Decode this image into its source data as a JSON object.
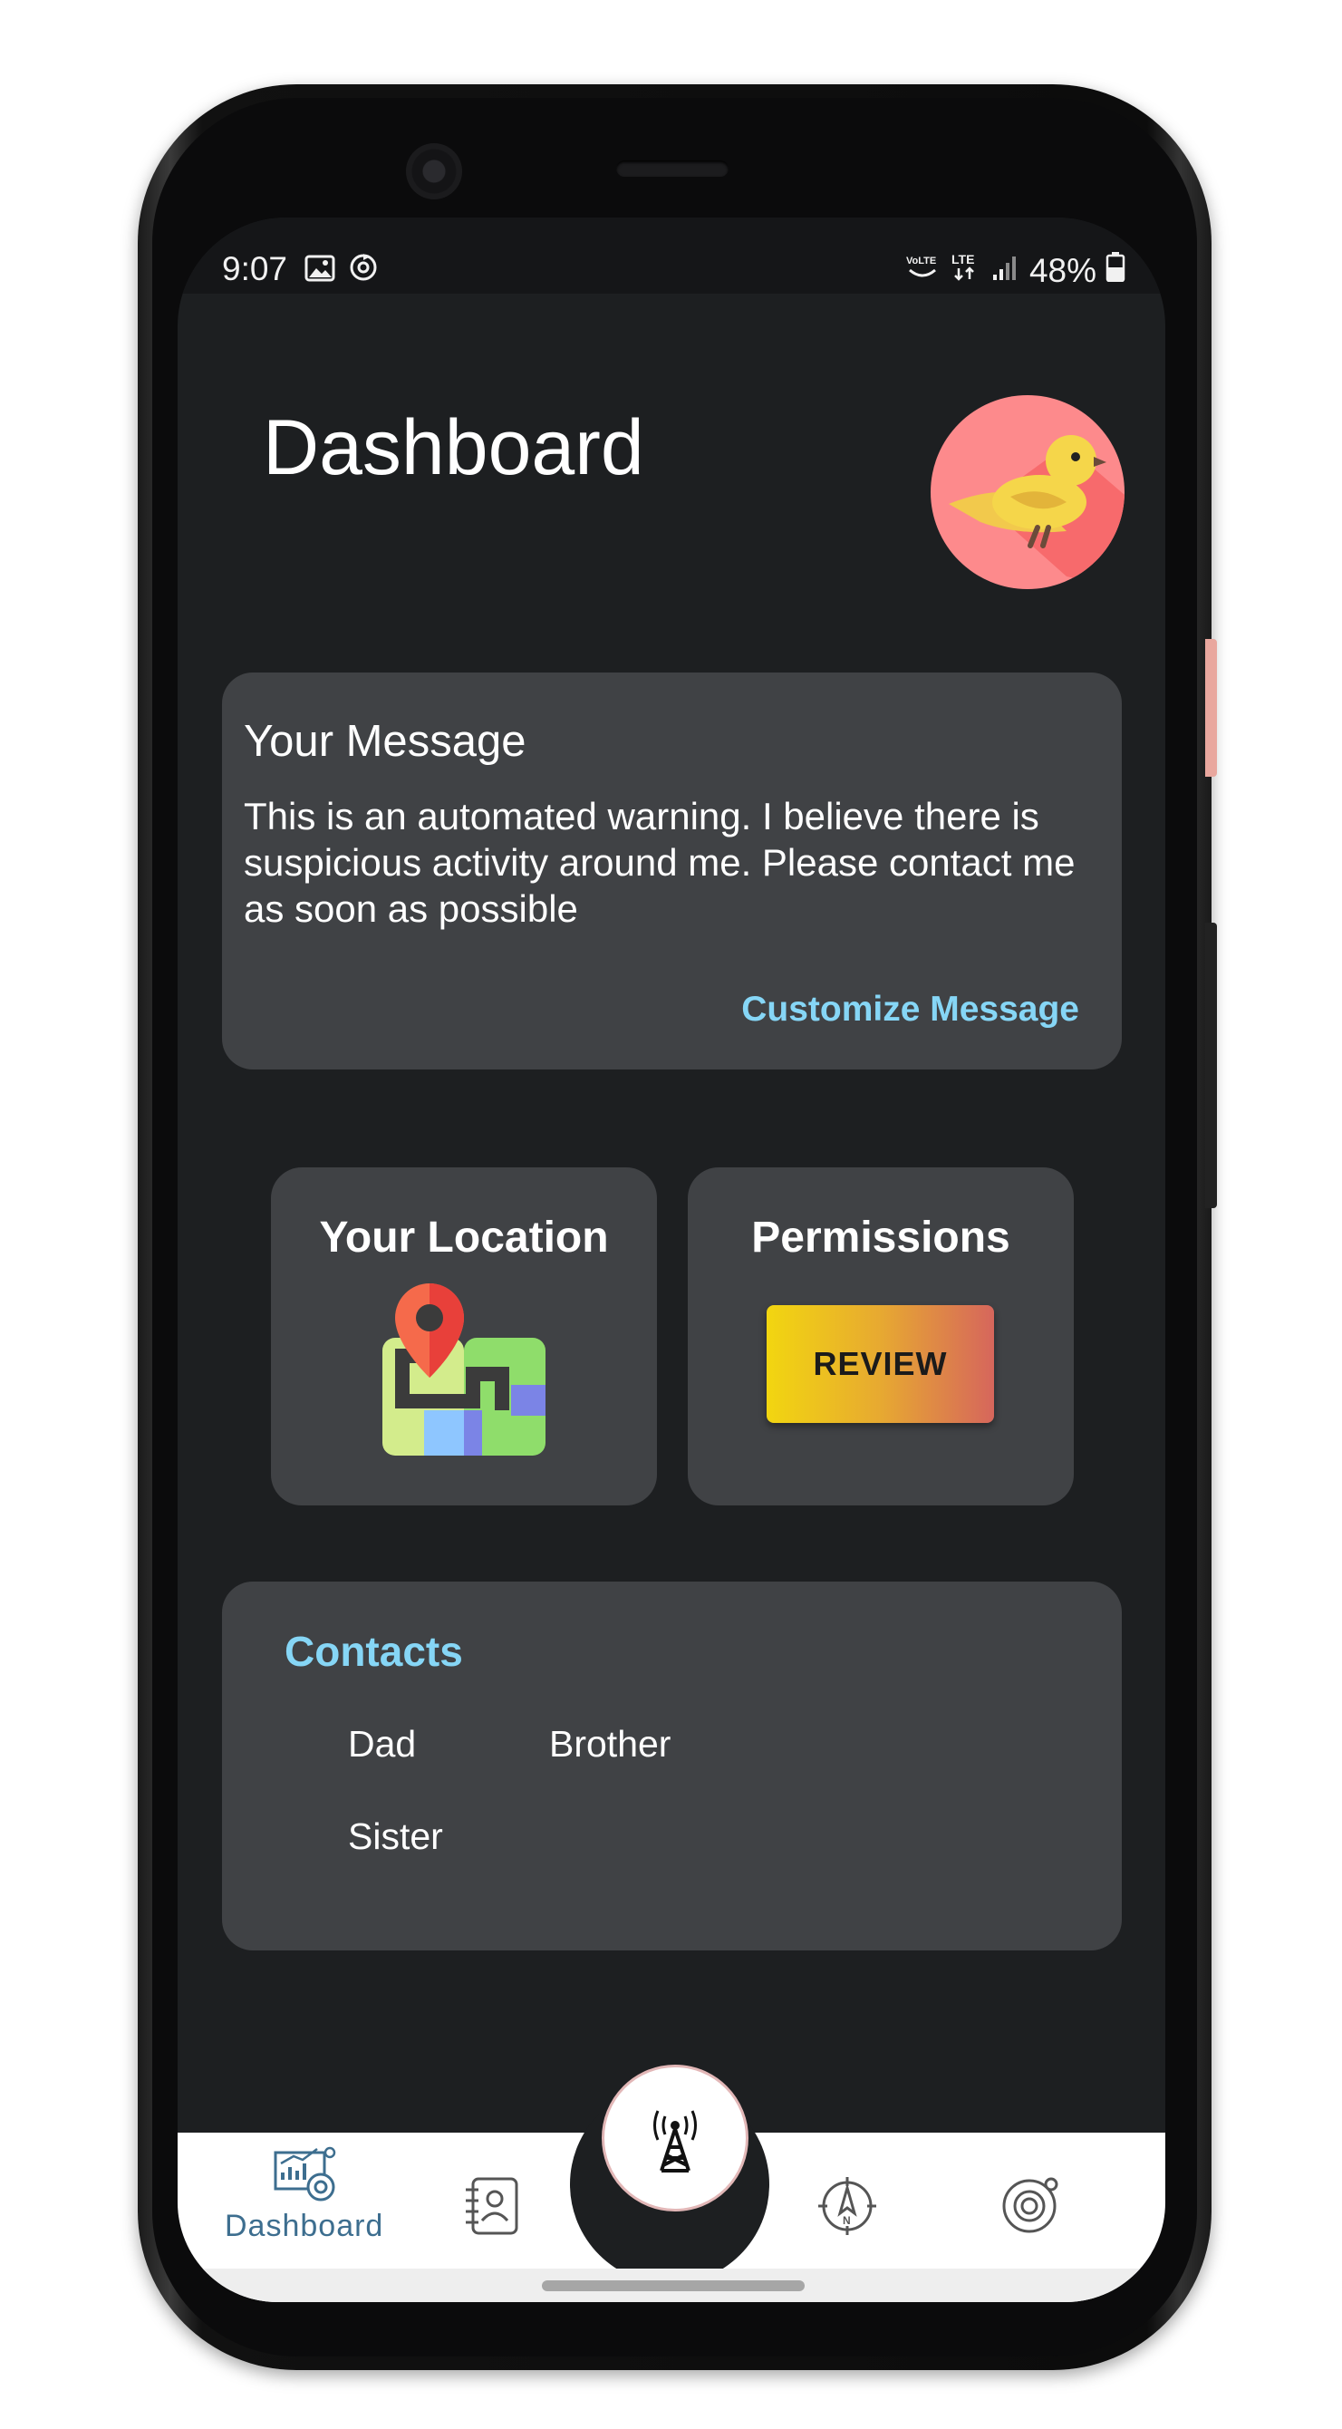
{
  "status_bar": {
    "time": "9:07",
    "network": "LTE",
    "volte": "VoLTE",
    "battery": "48%"
  },
  "header": {
    "title": "Dashboard"
  },
  "message_card": {
    "heading": "Your Message",
    "body": "This is an automated warning. I believe there is suspicious activity around me. Please contact me as soon as possible",
    "customize_label": "Customize Message"
  },
  "location_card": {
    "title": "Your Location"
  },
  "permissions_card": {
    "title": "Permissions",
    "review_label": "REVIEW"
  },
  "contacts_card": {
    "heading": "Contacts",
    "contacts": [
      "Dad",
      "Brother",
      "Sister"
    ]
  },
  "bottom_nav": {
    "items": [
      {
        "icon": "dashboard-icon",
        "label": "Dashboard",
        "active": true
      },
      {
        "icon": "contacts-book-icon",
        "label": ""
      },
      {
        "icon": "signal-tower-icon",
        "label": ""
      },
      {
        "icon": "compass-icon",
        "label": ""
      },
      {
        "icon": "orbit-settings-icon",
        "label": ""
      }
    ]
  },
  "colors": {
    "background": "#1d1f21",
    "card": "#404245",
    "accent": "#86d6f6",
    "nav_active": "#3d6e8f",
    "avatar_bg": "#fd8a8c"
  }
}
